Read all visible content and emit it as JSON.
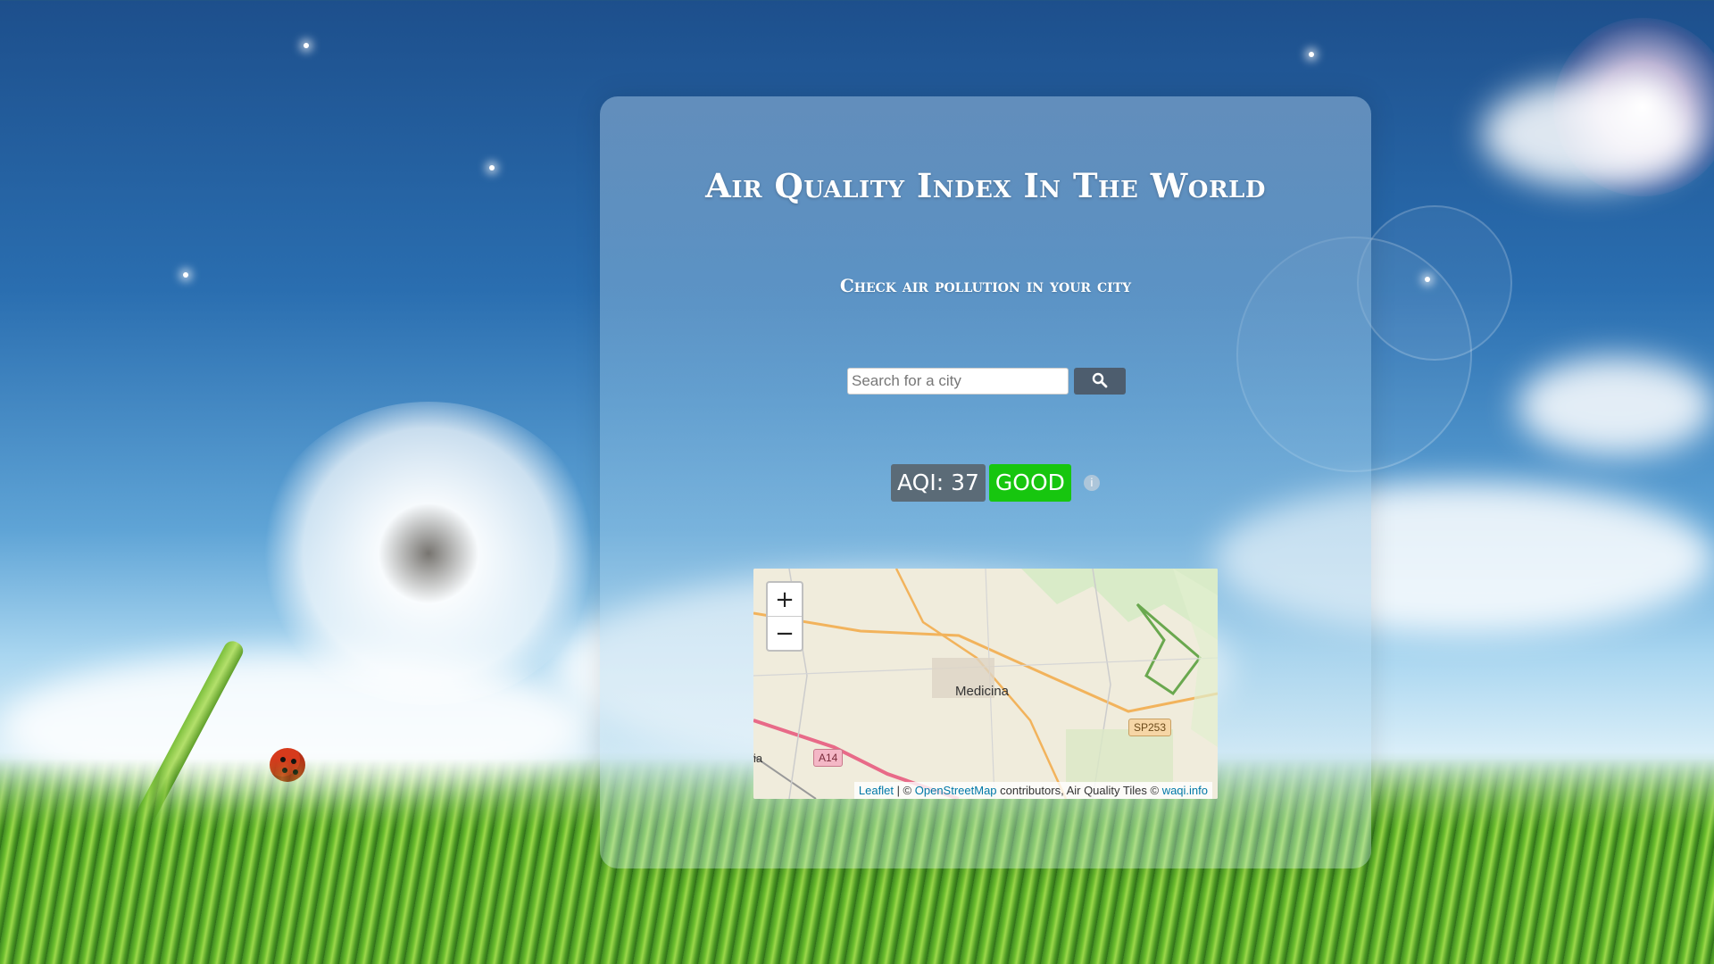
{
  "page": {
    "title": "Air Quality Index In The World",
    "subtitle": "Check air pollution in your city"
  },
  "search": {
    "placeholder": "Search for a city",
    "value": "",
    "button_icon": "search-icon"
  },
  "aqi": {
    "label": "AQI: 37",
    "level": "GOOD",
    "level_color": "#17c60f",
    "info_icon": "info-icon"
  },
  "map": {
    "zoom_in": "+",
    "zoom_out": "−",
    "town": "Medicina",
    "road_a14": "A14",
    "road_sp253": "SP253",
    "edge_label": "ia",
    "attribution": {
      "leaflet": "Leaflet",
      "sep1": " | © ",
      "osm": "OpenStreetMap",
      "middle": " contributors, Air Quality Tiles © ",
      "waqi": "waqi.info"
    }
  }
}
